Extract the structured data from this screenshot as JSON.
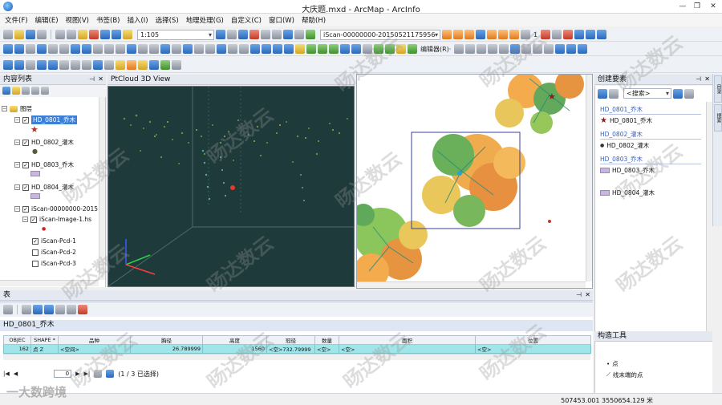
{
  "window": {
    "title": "大庆题.mxd - ArcMap - ArcInfo",
    "minimize": "—",
    "restore": "❐",
    "close": "✕"
  },
  "menu": [
    "文件(F)",
    "编辑(E)",
    "视图(V)",
    "书签(B)",
    "插入(I)",
    "选择(S)",
    "地理处理(G)",
    "自定义(C)",
    "窗口(W)",
    "帮助(H)"
  ],
  "toolbar": {
    "scale": "1:105",
    "scan_name": "iScan-00000000-20150521175956",
    "frame_number": "1",
    "editor_label": "编辑器(R)·"
  },
  "toc": {
    "title": "内容列表",
    "root": "图层",
    "layers": [
      {
        "name": "HD_0801_乔木",
        "checked": true,
        "selected": true
      },
      {
        "name": "HD_0802_灌木",
        "checked": true
      },
      {
        "name": "HD_0803_乔木",
        "checked": true
      },
      {
        "name": "HD_0804_灌木",
        "checked": true
      },
      {
        "name": "iScan-00000000-2015",
        "checked": true
      },
      {
        "name": "iScan-Image-1.hs",
        "checked": true
      },
      {
        "name": "iScan-Pcd-1",
        "checked": true
      },
      {
        "name": "iScan-Pcd-2",
        "checked": false
      },
      {
        "name": "iScan-Pcd-3",
        "checked": false
      }
    ]
  },
  "view3d": {
    "title": "PtCloud 3D View"
  },
  "create_features": {
    "title": "创建要素",
    "search_placeholder": "<搜索>",
    "groups": [
      {
        "header": "HD_0801_乔木",
        "item": "HD_0801_乔木"
      },
      {
        "header": "HD_0802_灌木",
        "item": "HD_0802_灌木"
      },
      {
        "header": "HD_0803_乔木",
        "item": "HD_0803_乔木"
      },
      {
        "header": "",
        "item": "HD_0804_灌木"
      }
    ],
    "side_tabs": [
      "目录",
      "搜索"
    ]
  },
  "construct_tools": {
    "title": "构造工具",
    "items": [
      "点",
      "线末端的点"
    ]
  },
  "table": {
    "title": "表",
    "layer_name": "HD_0801_乔木",
    "columns": [
      "OBJEC",
      "SHAPE *",
      "品种",
      "胸径",
      "高度",
      "冠径",
      "数量",
      "面积",
      "位置"
    ],
    "row": [
      "162",
      "点 Z",
      "<空间>",
      "26.789999",
      "1560",
      "<空>732.79999",
      "<空>",
      "<空>",
      "<空>"
    ],
    "nav_value": "0",
    "selection_status": "(1 / 3 已选择)"
  },
  "status": {
    "coords": "507453.001  3550654.129 米"
  },
  "watermark": {
    "text": "旸达数云",
    "brand": "一大数跨境"
  },
  "colors": {
    "selection": "#3b7fd6",
    "table_row": "#9fe5ea",
    "view3d_bg": "#1e3a3a",
    "group_header": "#3b5fb6"
  }
}
